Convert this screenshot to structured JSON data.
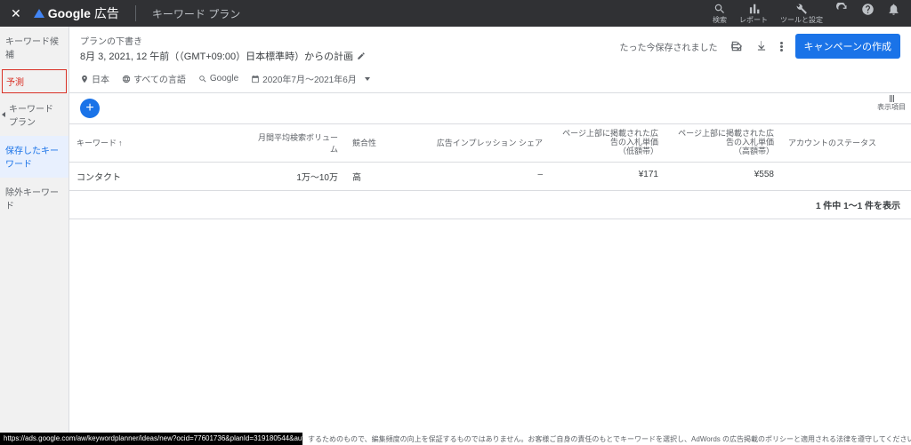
{
  "topbar": {
    "brand_bold": "Google",
    "brand_rest": " 広告",
    "section": "キーワード プラン",
    "tools": {
      "search": "検索",
      "report": "レポート",
      "tools": "ツールと設定"
    }
  },
  "sidebar": {
    "items": [
      {
        "label": "キーワード候補"
      },
      {
        "label": "予測"
      },
      {
        "label": "キーワード プラン"
      },
      {
        "label": "保存したキーワード"
      },
      {
        "label": "除外キーワード"
      }
    ]
  },
  "subheader": {
    "draft_label": "プランの下書き",
    "timestamp": "8月 3, 2021, 12 午前（（GMT+09:00）日本標準時）からの計画",
    "saved_msg": "たった今保存されました",
    "cta": "キャンペーンの作成"
  },
  "filters": {
    "location": "日本",
    "language": "すべての言語",
    "network": "Google",
    "daterange": "2020年7月～2021年6月"
  },
  "fabrow": {
    "right_label": "表示項目"
  },
  "table": {
    "headers": {
      "keyword": "キーワード",
      "volume": "月間平均検索ボリューム",
      "competition": "競合性",
      "impression": "広告インプレッション シェア",
      "bid_low_1": "ページ上部に掲載された広告の入札単価",
      "bid_low_2": "（低額帯）",
      "bid_high_1": "ページ上部に掲載された広告の入札単価",
      "bid_high_2": "（高額帯）",
      "status": "アカウントのステータス"
    },
    "row": {
      "keyword": "コンタクト",
      "volume": "1万～10万",
      "competition": "高",
      "impression": "–",
      "bid_low": "¥171",
      "bid_high": "¥558",
      "status": ""
    },
    "footer": "1 件中 1～1 件を表示"
  },
  "statusbar": {
    "url": "https://ads.google.com/aw/keywordplanner/ideas/new?ocid=77601736&planId=319180544&authuser=0&_u=68848...",
    "disclaimer": "するためのもので、編集頻度の向上を保証するものではありません。お客様ご自身の責任のもとでキーワードを選択し、AdWords の広告掲載のポリシーと適用される法律を遵守してください。"
  }
}
